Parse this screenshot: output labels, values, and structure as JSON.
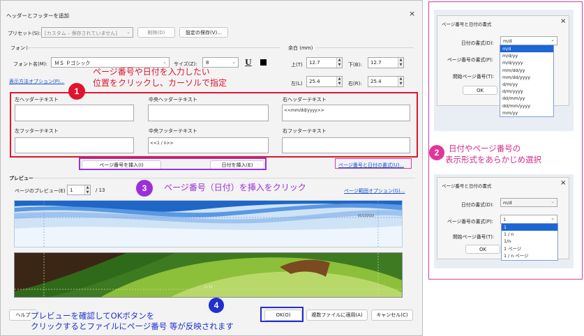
{
  "dialog": {
    "title": "ヘッダーとフッターを追加",
    "close_glyph": "×",
    "preset_label": "プリセット(S):",
    "preset_value": "[カスタム – 保存されていません]",
    "delete_btn": "削除(D)",
    "save_settings_btn": "設定の保存(V)...",
    "font_section": "フォント",
    "font_name_label": "フォント名(M):",
    "font_name_value": "ＭＳ Ｐゴシック",
    "size_label": "サイズ(Z):",
    "size_value": "8",
    "underline_glyph": "U",
    "margin_section": "余白 (mm)",
    "top_label": "上(T)",
    "top_value": "12.7",
    "bottom_label": "下(B):",
    "bottom_value": "12.7",
    "left_label": "左(L)",
    "left_value": "25.4",
    "right_label": "右(R):",
    "right_value": "25.4",
    "display_options_link": "表示方法オプション(P)...",
    "left_header_label": "左ヘッダーテキスト",
    "center_header_label": "中央ヘッダーテキスト",
    "right_header_label": "右ヘッダーテキスト",
    "right_header_value": "<<mm/dd/yyyy>>",
    "left_footer_label": "左フッターテキスト",
    "center_footer_label": "中央フッターテキスト",
    "center_footer_value": "<<1 / n>>",
    "right_footer_label": "右フッターテキスト",
    "insert_page_btn": "ページ番号を挿入(I)",
    "insert_date_btn": "日付を挿入(E)",
    "page_date_format_link": "ページ番号と日付の書式(U)...",
    "preview_section": "プレビュー",
    "page_preview_label": "ページのプレビュー(E)",
    "page_preview_value": "1",
    "page_total": "/ 13",
    "page_range_link": "ページ範囲オプション(G)...",
    "preview_header_text": "01/13/2024",
    "preview_footer_text": "1 / 13",
    "help_btn": "ヘルプ",
    "ok_btn": "OK(O)",
    "apply_multi_btn": "複数ファイルに適用(A)",
    "cancel_btn": "キャンセル(C)"
  },
  "annotations": {
    "badge1": "1",
    "text1_line1": "ページ番号や日付を入力したい",
    "text1_line2": "位置をクリックし、カーソルで指定",
    "badge2": "2",
    "text2_line1": "日付やページ番号の",
    "text2_line2": "表示形式をあらかじめ選択",
    "badge3": "3",
    "text3": "ページ番号（日付）を挿入をクリック",
    "badge4": "4",
    "text4_line1": "プレビューを確認してOKボタンを",
    "text4_line2": "クリックするとファイルにページ番号 等が反映されます"
  },
  "format_dialog_top": {
    "title": "ページ番号と日付の書式",
    "close_glyph": "×",
    "date_format_label": "日付の書式(D):",
    "date_format_value": "m/d",
    "page_format_label": "ページ番号の書式(P):",
    "start_page_label": "開始ページ番号(T):",
    "ok_btn": "OK",
    "date_options": [
      "m/d",
      "m/d/yy",
      "m/d/yyyy",
      "mm/dd/yy",
      "mm/dd/yyyy",
      "d/m/yy",
      "d/m/yyyy",
      "dd/mm/yy",
      "dd/mm/yyyy",
      "mm/yy"
    ]
  },
  "format_dialog_bottom": {
    "title": "ページ番号と日付の書式",
    "close_glyph": "×",
    "date_format_label": "日付の書式(D):",
    "date_format_value": "m/d",
    "page_format_label": "ページ番号の書式(P):",
    "page_format_value": "1",
    "start_page_label": "開始ページ番号(T):",
    "ok_btn": "OK",
    "page_options": [
      "1",
      "1 / n",
      "1/n",
      "1 ページ",
      "1 / n ページ"
    ]
  },
  "colors": {
    "red_annotation": "#e0142e",
    "purple_annotation": "#9b30d9",
    "blue_annotation": "#1f2fd0",
    "magenta_frame": "#d23ca5",
    "selection": "#1c66d6"
  }
}
